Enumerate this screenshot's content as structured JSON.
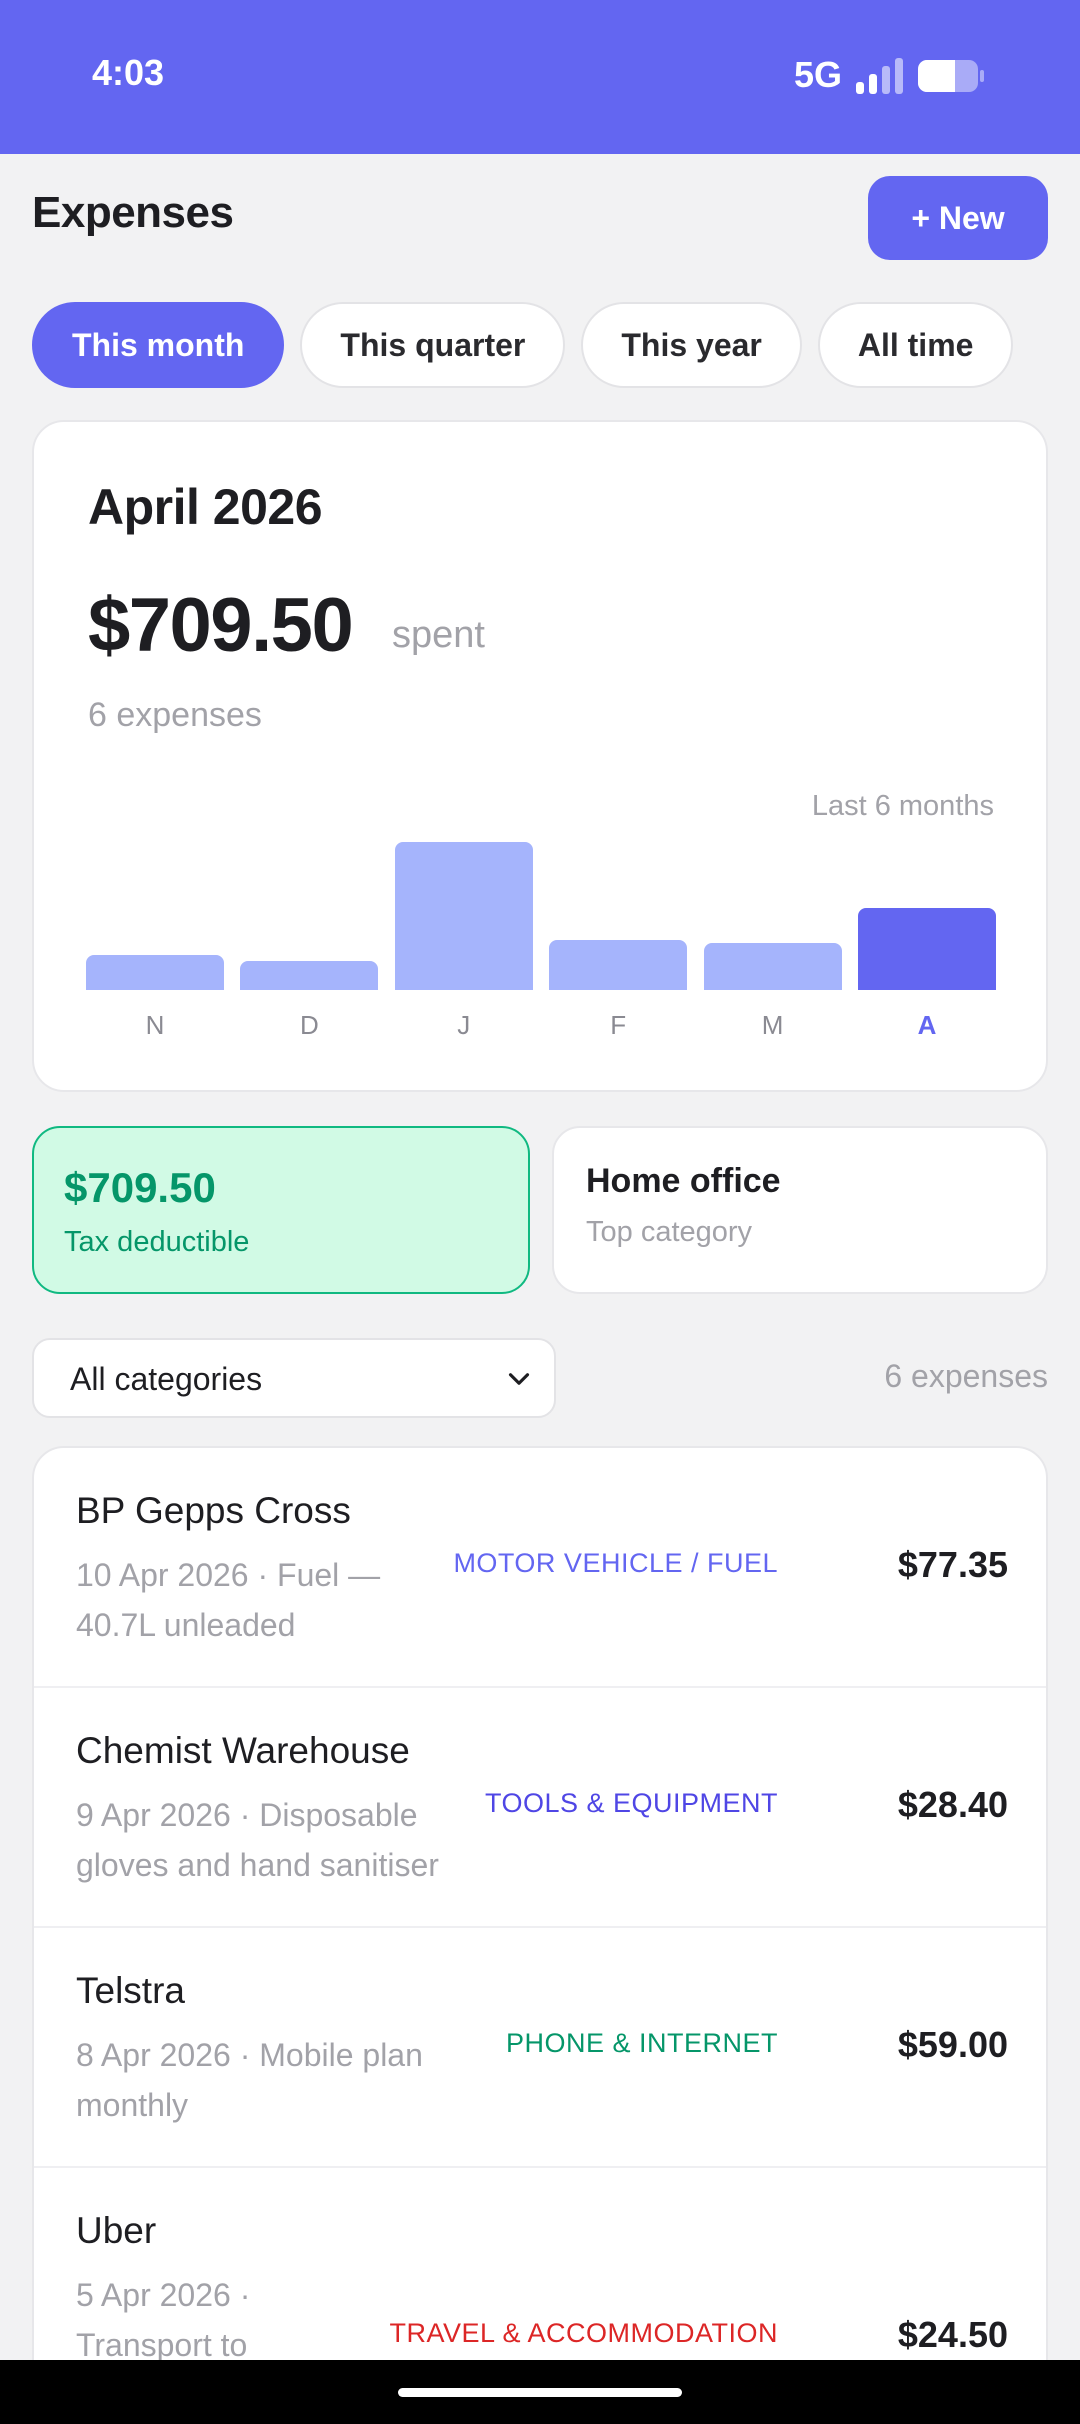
{
  "status": {
    "time": "4:03",
    "network": "5G",
    "battery_level": 0.62
  },
  "header": {
    "title": "Expenses",
    "new_label": "+ New"
  },
  "filters": [
    {
      "label": "This month",
      "active": true
    },
    {
      "label": "This quarter",
      "active": false
    },
    {
      "label": "This year",
      "active": false
    },
    {
      "label": "All time",
      "active": false
    }
  ],
  "summary": {
    "month": "April 2026",
    "amount": "$709.50",
    "spent_label": "spent",
    "count": "6 expenses",
    "range_label": "Last 6 months"
  },
  "chart_data": {
    "type": "bar",
    "categories": [
      "N",
      "D",
      "J",
      "F",
      "M",
      "A"
    ],
    "values": [
      170,
      140,
      710,
      240,
      225,
      395
    ],
    "highlight_index": 5,
    "colors": {
      "bar": "#a5b4fc",
      "current": "#6366f1"
    }
  },
  "stats": {
    "tax_amount": "$709.50",
    "tax_label": "Tax deductible",
    "top_category": "Home office",
    "top_label": "Top category"
  },
  "list_controls": {
    "category_value": "All categories",
    "count": "6 expenses"
  },
  "expenses": [
    {
      "merchant": "BP Gepps Cross",
      "meta": "10 Apr 2026 · Fuel — 40.7L unleaded",
      "category": "MOTOR VEHICLE / FUEL",
      "category_color": "#6366f1",
      "amount": "$77.35"
    },
    {
      "merchant": "Chemist Warehouse",
      "meta": "9 Apr 2026 · Disposable gloves and hand sanitiser",
      "category": "TOOLS & EQUIPMENT",
      "category_color": "#4f46e5",
      "amount": "$28.40"
    },
    {
      "merchant": "Telstra",
      "meta": "8 Apr 2026 · Mobile plan monthly",
      "category": "PHONE & INTERNET",
      "category_color": "#059669",
      "amount": "$59.00"
    },
    {
      "merchant": "Uber",
      "meta": "5 Apr 2026 · Transport to",
      "category": "TRAVEL & ACCOMMODATION",
      "category_color": "#dc2626",
      "amount": "$24.50"
    }
  ]
}
